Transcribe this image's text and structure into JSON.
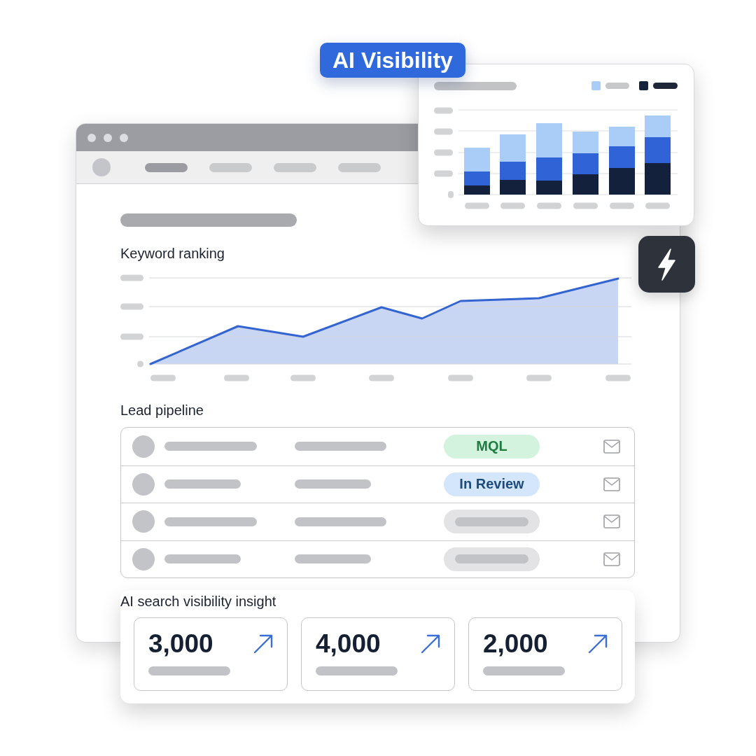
{
  "badge": {
    "label": "AI Visibility"
  },
  "chart_card": {
    "legend": [
      {
        "color": "#a9cdf7"
      },
      {
        "color": "#15223b"
      }
    ],
    "series": [
      {
        "color": "#14213d"
      },
      {
        "color": "#2f63d6"
      },
      {
        "color": "#a9cdf7"
      }
    ]
  },
  "window": {
    "nav_tabs": [
      {
        "selected": true
      },
      {
        "selected": false
      },
      {
        "selected": false
      },
      {
        "selected": false
      }
    ],
    "line_chart": {
      "title": "Keyword ranking"
    },
    "lead_pipeline": {
      "title": "Lead pipeline",
      "rows": [
        {
          "kind": "badge",
          "status": "MQL",
          "color": "#d3f3de"
        },
        {
          "kind": "badge",
          "status": "In Review",
          "color": "#d3e6fb"
        },
        {
          "kind": "skeleton"
        },
        {
          "kind": "skeleton"
        }
      ]
    }
  },
  "insight_panel": {
    "title": "AI search visibility insight",
    "stats": [
      {
        "value": "3,000"
      },
      {
        "value": "4,000"
      },
      {
        "value": "2,000"
      }
    ]
  }
}
